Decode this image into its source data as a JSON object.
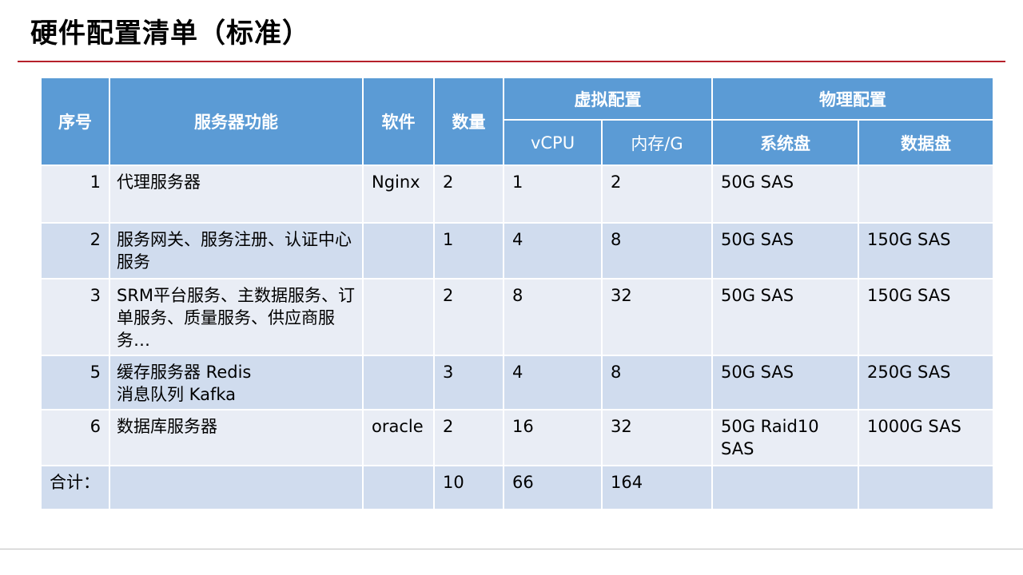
{
  "title": "硬件配置清单（标准）",
  "table": {
    "headers": {
      "seq": "序号",
      "function": "服务器功能",
      "software": "软件",
      "qty": "数量",
      "virtual": "虚拟配置",
      "physical": "物理配置",
      "vcpu": "vCPU",
      "mem": "内存/G",
      "sysdisk": "系统盘",
      "datadisk": "数据盘"
    },
    "rows": [
      {
        "seq": "1",
        "function": "代理服务器",
        "software": "Nginx",
        "qty": "2",
        "vcpu": "1",
        "mem": "2",
        "sysdisk": "50G SAS",
        "datadisk": ""
      },
      {
        "seq": "2",
        "function": "服务网关、服务注册、认证中心服务",
        "software": "",
        "qty": "1",
        "vcpu": "4",
        "mem": "8",
        "sysdisk": "50G SAS",
        "datadisk": "150G SAS"
      },
      {
        "seq": "3",
        "function": "SRM平台服务、主数据服务、订单服务、质量服务、供应商服务…",
        "software": "",
        "qty": "2",
        "vcpu": "8",
        "mem": "32",
        "sysdisk": "50G SAS",
        "datadisk": "150G SAS"
      },
      {
        "seq": "5",
        "function_line1": "缓存服务器 Redis",
        "function_line2": "消息队列 Kafka",
        "software": "",
        "qty": "3",
        "vcpu": "4",
        "mem": "8",
        "sysdisk": "50G SAS",
        "datadisk": "250G SAS"
      },
      {
        "seq": "6",
        "function": "数据库服务器",
        "software": "oracle",
        "qty": "2",
        "vcpu": "16",
        "mem": "32",
        "sysdisk": "50G Raid10 SAS",
        "datadisk": "1000G SAS"
      }
    ],
    "total": {
      "label": "合计：",
      "qty": "10",
      "vcpu": "66",
      "mem": "164"
    }
  }
}
